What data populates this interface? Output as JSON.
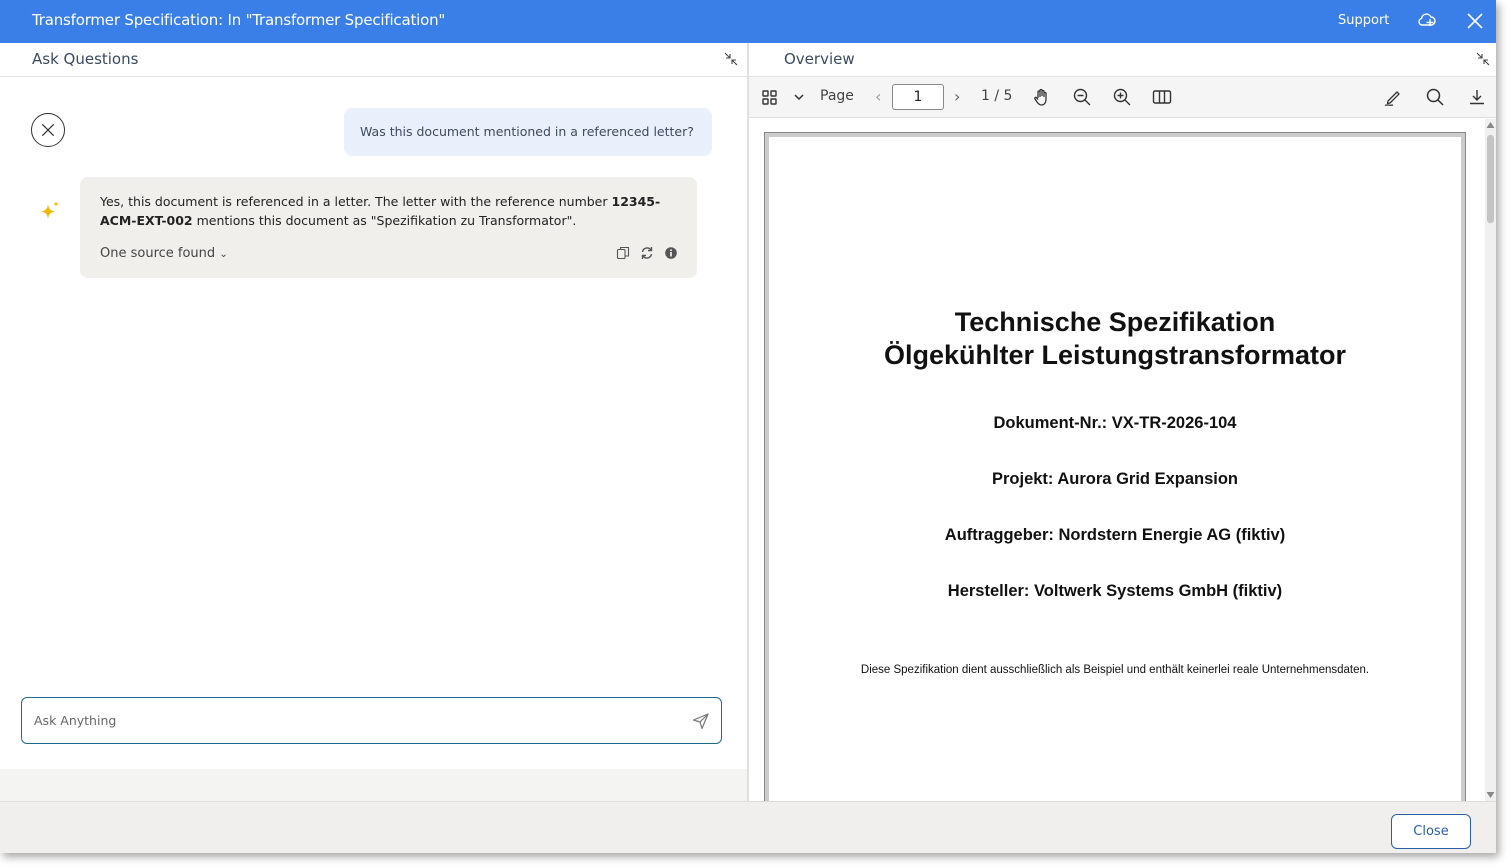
{
  "window": {
    "title": "Transformer Specification: In \"Transformer Specification\"",
    "support_label": "Support",
    "colors": {
      "titlebar": "#3a7ee8",
      "accent": "#2a5fa8",
      "sparkle": "#f5b800"
    }
  },
  "left_pane": {
    "title": "Ask Questions",
    "user_message": "Was this document mentioned in a referenced letter?",
    "ai_message": {
      "text_before": "Yes, this document is referenced in a letter. The letter with the reference number ",
      "reference_number": "12345-ACM-EXT-002",
      "text_after": " mentions this document as \"Spezifikation zu Transformator\".",
      "sources_label": "One source found"
    },
    "input": {
      "placeholder": "Ask Anything",
      "value": ""
    }
  },
  "right_pane": {
    "title": "Overview",
    "toolbar": {
      "page_label": "Page",
      "page_value": "1",
      "page_total": "1 / 5"
    },
    "document": {
      "title_line1": "Technische Spezifikation",
      "title_line2": "Ölgekühlter Leistungstransformator",
      "doc_number": "Dokument-Nr.: VX-TR-2026-104",
      "project": "Projekt: Aurora Grid Expansion",
      "client": "Auftraggeber: Nordstern Energie AG (fiktiv)",
      "manufacturer": "Hersteller: Voltwerk Systems GmbH (fiktiv)",
      "note": "Diese Spezifikation dient ausschließlich als Beispiel und enthält keinerlei reale Unternehmensdaten."
    }
  },
  "footer": {
    "close_label": "Close"
  }
}
